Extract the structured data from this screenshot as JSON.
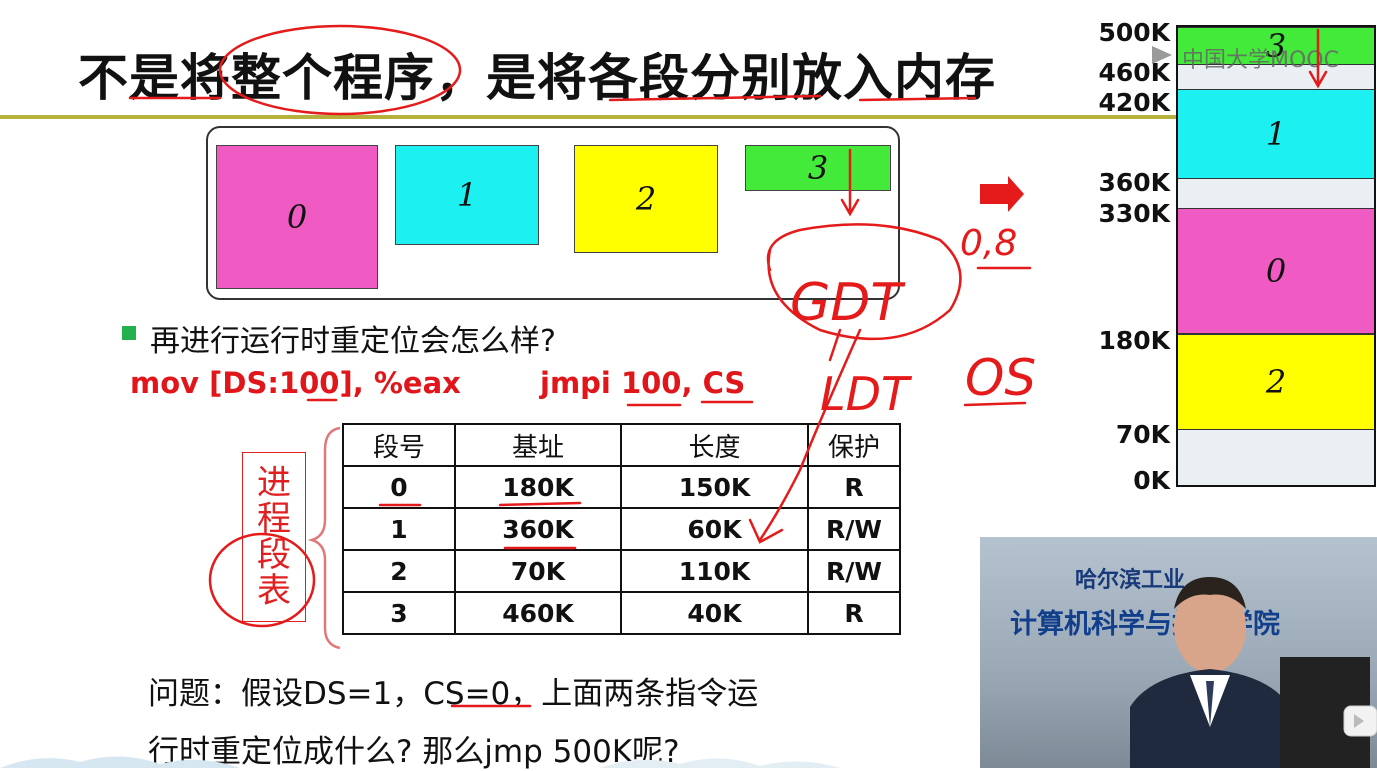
{
  "slide": {
    "title": "不是将整个程序，是将各段分别放入内存",
    "segments": [
      "0",
      "1",
      "2",
      "3"
    ],
    "question": "再进行运行时重定位会怎么样?",
    "code_left": "mov [DS:100], %eax",
    "code_right": "jmpi 100, CS",
    "stamp_chars": [
      "进",
      "程",
      "段",
      "表"
    ],
    "table": {
      "headers": [
        "段号",
        "基址",
        "长度",
        "保护"
      ],
      "rows": [
        [
          "0",
          "180K",
          "150K",
          "R"
        ],
        [
          "1",
          "360K",
          "60K",
          "R/W"
        ],
        [
          "2",
          "70K",
          "110K",
          "R/W"
        ],
        [
          "3",
          "460K",
          "40K",
          "R"
        ]
      ]
    },
    "problem_line1": "问题：假设DS=1，CS=0，上面两条指令运",
    "problem_line2": "行时重定位成什么? 那么jmp 500K呢?"
  },
  "memory": {
    "labels": [
      "500K",
      "460K",
      "420K",
      "360K",
      "330K",
      "180K",
      "70K",
      "0K"
    ],
    "blocks": [
      "3",
      "1",
      "0",
      "2"
    ],
    "colors": {
      "seg0": "#f05bc3",
      "seg1": "#1cf0f0",
      "seg2": "#ffff00",
      "seg3": "#44ea3a",
      "free": "#e9eff2"
    }
  },
  "handwriting": {
    "gdt": "GDT",
    "ldt": "LDT",
    "os": "OS",
    "num": "0,8"
  },
  "video": {
    "header_line1": "哈尔滨工业",
    "header_line2": "计算机科学与技术学院"
  },
  "watermark": "中国大学MOOC",
  "annotation_color": "#e51a1a"
}
